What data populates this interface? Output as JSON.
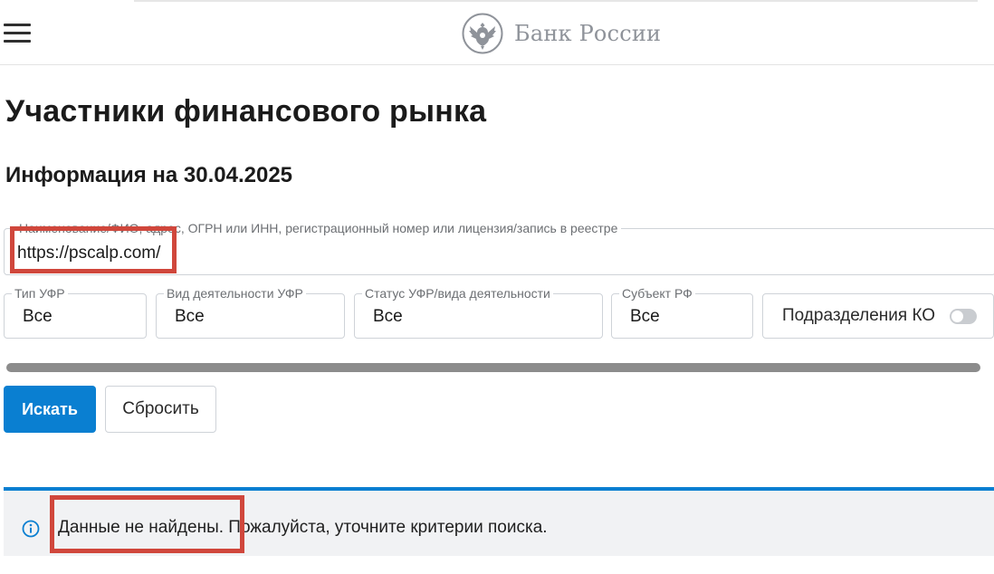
{
  "header": {
    "menu_icon": "hamburger-menu-icon",
    "logo_icon": "double-headed-eagle-emblem",
    "bank_name": "Банк России"
  },
  "page": {
    "title": "Участники финансового рынка",
    "info_date": "Информация на 30.04.2025"
  },
  "search": {
    "label": "Наименование/ФИО, адрес, ОГРН или ИНН, регистрационный номер или лицензия/запись в реестре",
    "value": "https://pscalp.com/"
  },
  "filters": [
    {
      "label": "Тип УФР",
      "value": "Все"
    },
    {
      "label": "Вид деятельности УФР",
      "value": "Все"
    },
    {
      "label": "Статус УФР/вида деятельности",
      "value": "Все"
    },
    {
      "label": "Субъект РФ",
      "value": "Все"
    }
  ],
  "toggle": {
    "label": "Подразделения КО",
    "checked": false
  },
  "buttons": {
    "search_label": "Искать",
    "reset_label": "Сбросить"
  },
  "notice": {
    "icon": "info-circle-icon",
    "text": "Данные не найдены. Пожалуйста, уточните критерии поиска."
  },
  "colors": {
    "accent": "#0a7fd1",
    "highlight": "#d0473c",
    "notice_bg": "#f1f2f4"
  }
}
